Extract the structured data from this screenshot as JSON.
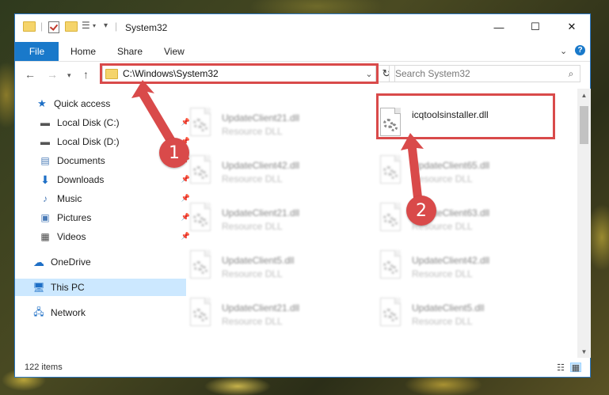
{
  "titlebar": {
    "title": "System32",
    "minimize_glyph": "—",
    "maximize_glyph": "☐",
    "close_glyph": "✕"
  },
  "ribbon": {
    "file_label": "File",
    "tabs": [
      "Home",
      "Share",
      "View"
    ],
    "help_glyph": "?"
  },
  "navigation": {
    "address": "C:\\Windows\\System32",
    "search_placeholder": "Search System32"
  },
  "sidebar": {
    "items": [
      {
        "label": "Quick access",
        "icon": "star-icon"
      },
      {
        "label": "Local Disk (C:)",
        "icon": "drive-icon"
      },
      {
        "label": "Local Disk (D:)",
        "icon": "drive-icon"
      },
      {
        "label": "Documents",
        "icon": "documents-icon"
      },
      {
        "label": "Downloads",
        "icon": "download-icon"
      },
      {
        "label": "Music",
        "icon": "music-icon"
      },
      {
        "label": "Pictures",
        "icon": "pictures-icon"
      },
      {
        "label": "Videos",
        "icon": "videos-icon"
      },
      {
        "label": "OneDrive",
        "icon": "cloud-icon"
      },
      {
        "label": "This PC",
        "icon": "computer-icon"
      },
      {
        "label": "Network",
        "icon": "network-icon"
      }
    ]
  },
  "files": [
    {
      "name": "UpdateClient21.dll",
      "type": "Resource DLL"
    },
    {
      "name": "icqtoolsinstaller.dll",
      "type": ""
    },
    {
      "name": "UpdateClient42.dll",
      "type": "Resource DLL"
    },
    {
      "name": "UpdateClient65.dll",
      "type": "Resource DLL"
    },
    {
      "name": "UpdateClient21.dll",
      "type": "Resource DLL"
    },
    {
      "name": "UpdateClient63.dll",
      "type": "Resource DLL"
    },
    {
      "name": "UpdateClient5.dll",
      "type": "Resource DLL"
    },
    {
      "name": "UpdateClient42.dll",
      "type": "Resource DLL"
    },
    {
      "name": "UpdateClient21.dll",
      "type": "Resource DLL"
    },
    {
      "name": "UpdateClient5.dll",
      "type": "Resource DLL"
    }
  ],
  "status": {
    "item_count": "122 items"
  },
  "annotations": {
    "step1": "1",
    "step2": "2",
    "color": "#d94a4a"
  }
}
